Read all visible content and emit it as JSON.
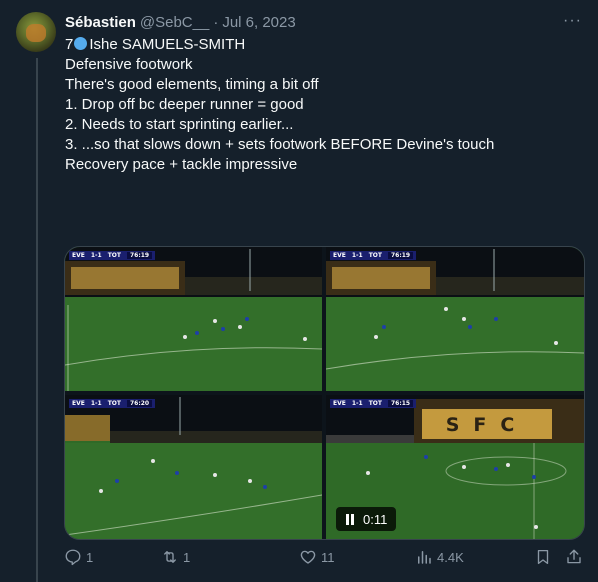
{
  "author": {
    "name": "Sébastien",
    "handle": "@SebC__",
    "date": "Jul 6, 2023"
  },
  "more_label": "···",
  "tweet": {
    "lines": [
      "7",
      "Ishe SAMUELS-SMITH",
      "",
      "Defensive footwork",
      "There's good elements, timing a bit off",
      "",
      "1. Drop off bc deeper runner = good",
      "2. Needs to start sprinting earlier...",
      "3. ...so that slows down + sets footwork BEFORE Devine's touch",
      "",
      "Recovery pace + tackle impressive"
    ]
  },
  "media": {
    "tiles": [
      {
        "home": "EVE",
        "score": "1-1",
        "away": "TOT",
        "clock": "76:19"
      },
      {
        "home": "EVE",
        "score": "1-1",
        "away": "TOT",
        "clock": "76:19"
      },
      {
        "home": "EVE",
        "score": "1-1",
        "away": "TOT",
        "clock": "76:20"
      },
      {
        "home": "EVE",
        "score": "1-1",
        "away": "TOT",
        "clock": "76:15"
      }
    ],
    "stand_text": "SFC",
    "duration": "0:11"
  },
  "actions": {
    "replies": "1",
    "reposts": "1",
    "likes": "11",
    "views": "4.4K"
  },
  "colors": {
    "background": "#15202b",
    "text": "#f7f9f9",
    "muted": "#8b98a5",
    "pitch": "#2f6a27"
  }
}
